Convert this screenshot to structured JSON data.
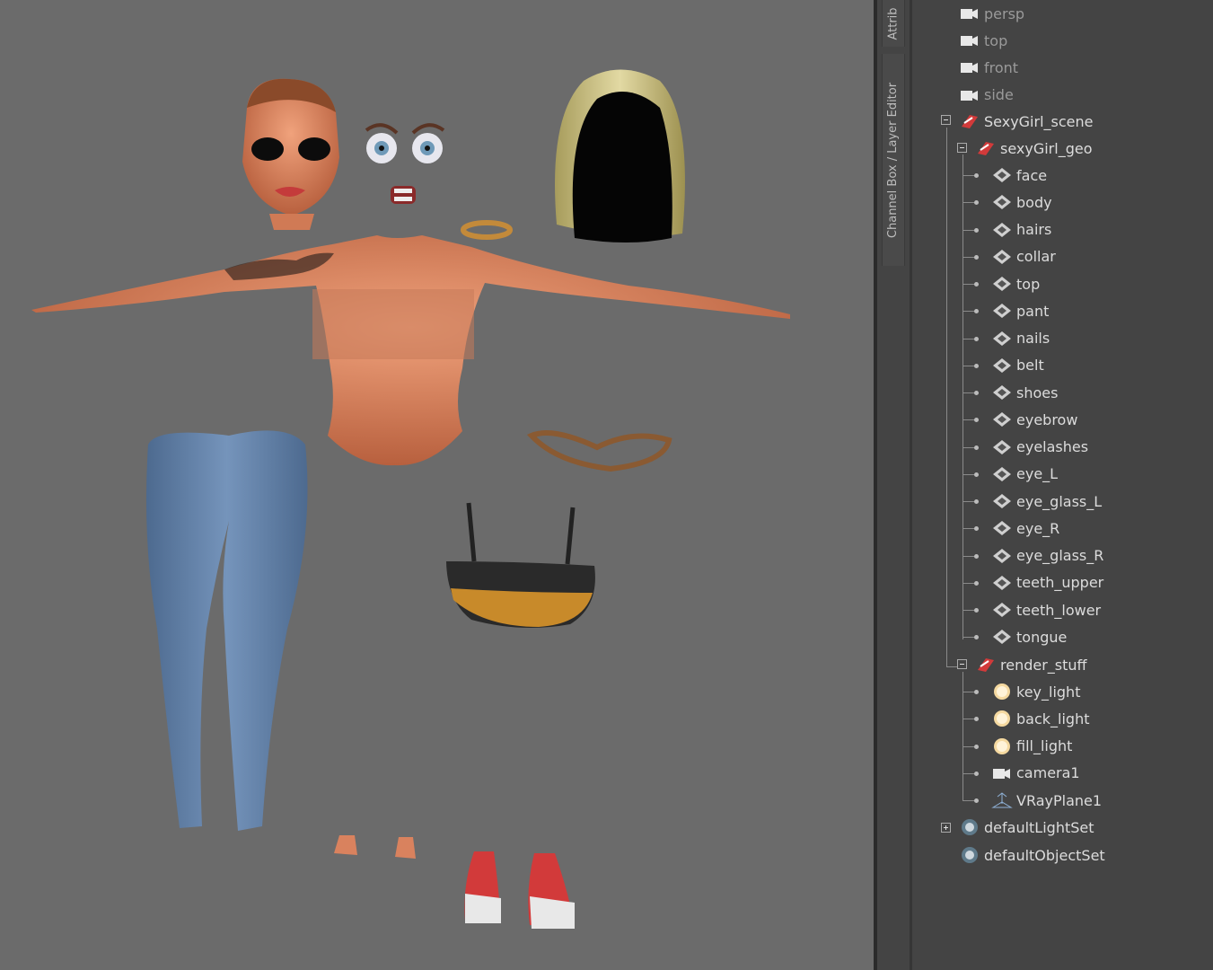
{
  "side_tabs": {
    "attribute_editor": "Attrib",
    "channel_box": "Channel Box / Layer Editor"
  },
  "outliner": {
    "cameras": [
      {
        "label": "persp",
        "icon": "camera-icon"
      },
      {
        "label": "top",
        "icon": "camera-icon"
      },
      {
        "label": "front",
        "icon": "camera-icon"
      },
      {
        "label": "side",
        "icon": "camera-icon"
      }
    ],
    "scene": {
      "label": "SexyGirl_scene",
      "icon": "group-icon"
    },
    "geo_group": {
      "label": "sexyGirl_geo",
      "icon": "group-icon"
    },
    "geo_items": [
      {
        "label": "face"
      },
      {
        "label": "body"
      },
      {
        "label": "hairs"
      },
      {
        "label": "collar"
      },
      {
        "label": "top"
      },
      {
        "label": "pant"
      },
      {
        "label": "nails"
      },
      {
        "label": "belt"
      },
      {
        "label": "shoes"
      },
      {
        "label": "eyebrow"
      },
      {
        "label": "eyelashes"
      },
      {
        "label": "eye_L"
      },
      {
        "label": "eye_glass_L"
      },
      {
        "label": "eye_R"
      },
      {
        "label": "eye_glass_R"
      },
      {
        "label": "teeth_upper"
      },
      {
        "label": "teeth_lower"
      },
      {
        "label": "tongue"
      }
    ],
    "render_group": {
      "label": "render_stuff",
      "icon": "group-icon"
    },
    "render_items": [
      {
        "label": "key_light",
        "icon": "light-icon"
      },
      {
        "label": "back_light",
        "icon": "light-icon"
      },
      {
        "label": "fill_light",
        "icon": "light-icon"
      },
      {
        "label": "camera1",
        "icon": "camera-icon"
      },
      {
        "label": "VRayPlane1",
        "icon": "vray-plane-icon"
      }
    ],
    "sets": [
      {
        "label": "defaultLightSet",
        "icon": "set-icon"
      },
      {
        "label": "defaultObjectSet",
        "icon": "set-icon"
      }
    ]
  },
  "colors": {
    "viewport_bg": "#6b6b6b",
    "panel_bg": "#444444",
    "skin": "#d9825e",
    "denim": "#5f7fa6",
    "hair": "#c9c08a"
  }
}
